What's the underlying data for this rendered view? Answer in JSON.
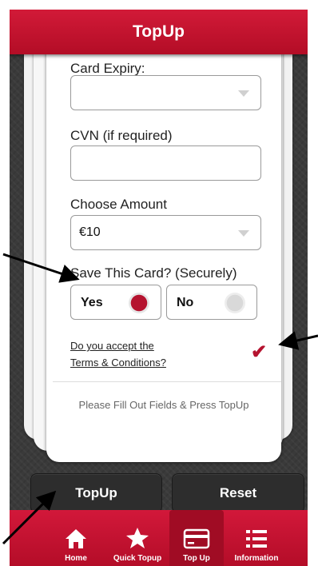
{
  "header": {
    "title": "TopUp"
  },
  "form": {
    "card_expiry_label": "Card Expiry:",
    "card_expiry_value": "",
    "cvn_label": "CVN (if required)",
    "cvn_value": "",
    "amount_label": "Choose Amount",
    "amount_value": "€10",
    "save_card_label": "Save This Card? (Securely)",
    "save_yes_label": "Yes",
    "save_no_label": "No",
    "save_card_selected": "Yes",
    "terms_line1": "Do you accept the",
    "terms_line2": "Terms & Conditions?",
    "terms_accepted": true,
    "hint": "Please Fill Out Fields & Press TopUp"
  },
  "actions": {
    "topup_label": "TopUp",
    "reset_label": "Reset"
  },
  "tabbar": {
    "items": [
      {
        "label": "Home",
        "icon": "home-icon"
      },
      {
        "label": "Quick Topup",
        "icon": "star-icon"
      },
      {
        "label": "Top Up",
        "icon": "credit-card-icon"
      },
      {
        "label": "Information",
        "icon": "list-icon"
      }
    ],
    "active": "Top Up"
  },
  "colors": {
    "brand": "#c8102e",
    "radio_selected": "#b5132f",
    "radio_unselected": "#d9d9d9",
    "background": "#3a3a3a"
  }
}
